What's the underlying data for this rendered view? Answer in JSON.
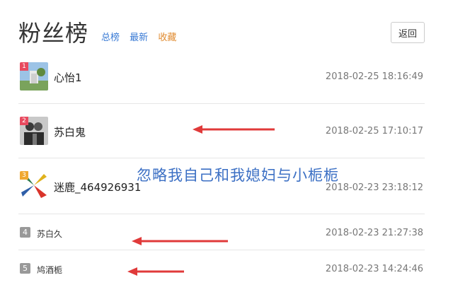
{
  "header": {
    "title": "粉丝榜",
    "tabs": [
      "总榜",
      "最新",
      "收藏"
    ],
    "back_label": "返回"
  },
  "rows": [
    {
      "rank": "1",
      "name": "心怡1",
      "time": "2018-02-25 18:16:49"
    },
    {
      "rank": "2",
      "name": "苏白鬼",
      "time": "2018-02-25 17:10:17"
    },
    {
      "rank": "3",
      "name": "迷鹿_464926931",
      "time": "2018-02-23 23:18:12"
    },
    {
      "rank": "4",
      "name": "苏白久",
      "time": "2018-02-23 21:27:38"
    },
    {
      "rank": "5",
      "name": "鸠酒栀",
      "time": "2018-02-23 14:24:46"
    }
  ],
  "annotation": "忽略我自己和我媳妇与小栀栀",
  "colors": {
    "accent_blue": "#3a7bd5",
    "accent_orange": "#e08a2e",
    "rank_badge": "#e84a5f",
    "arrow_red": "#e03a3a"
  }
}
